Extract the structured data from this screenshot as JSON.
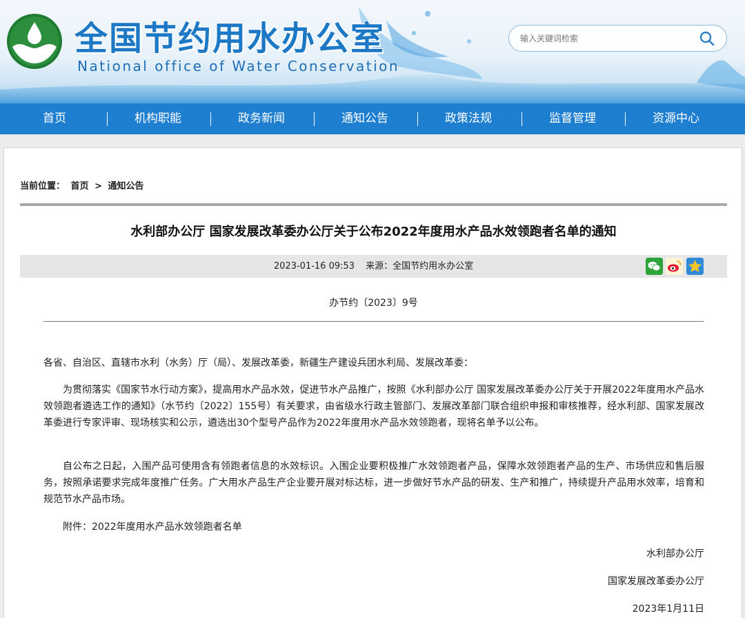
{
  "site": {
    "title": "全国节约用水办公室",
    "subtitle": "National office of Water Conservation"
  },
  "search": {
    "placeholder": "输入关键词检索",
    "icon": "search-icon"
  },
  "nav": {
    "items": [
      {
        "label": "首页"
      },
      {
        "label": "机构职能"
      },
      {
        "label": "政务新闻"
      },
      {
        "label": "通知公告"
      },
      {
        "label": "政策法规"
      },
      {
        "label": "监督管理"
      },
      {
        "label": "资源中心"
      }
    ],
    "separator": "|"
  },
  "breadcrumb": {
    "prefix": "当前位置：",
    "home": "首页",
    "arrow": ">",
    "current": "通知公告"
  },
  "article": {
    "title": "水利部办公厅 国家发展改革委办公厅关于公布2022年度用水产品水效领跑者名单的通知",
    "date": "2023-01-16 09:53",
    "source": "来源：全国节约用水办公室",
    "doc_no": "办节约〔2023〕9号",
    "salutation": "各省、自治区、直辖市水利（水务）厅（局）、发展改革委，新疆生产建设兵团水利局、发展改革委：",
    "paragraphs": [
      "为贯彻落实《国家节水行动方案》，提高用水产品水效，促进节水产品推广，按照《水利部办公厅 国家发展改革委办公厅关于开展2022年度用水产品水效领跑者遴选工作的通知》（水节约〔2022〕155号）有关要求，由省级水行政主管部门、发展改革部门联合组织申报和审核推荐，经水利部、国家发展改革委进行专家评审、现场核实和公示，遴选出30个型号产品作为2022年度用水产品水效领跑者，现将名单予以公布。",
      "自公布之日起，入围产品可使用含有领跑者信息的水效标识。入围企业要积极推广水效领跑者产品，保障水效领跑者产品的生产、市场供应和售后服务，按照承诺要求完成年度推广任务。广大用水产品生产企业要开展对标达标，进一步做好节水产品的研发、生产和推广，持续提升产品用水效率，培育和规范节水产品市场。"
    ],
    "attachment": "附件：2022年度用水产品水效领跑者名单",
    "signatories": [
      "水利部办公厅",
      "国家发展改革委办公厅"
    ],
    "sign_date": "2023年1月11日"
  },
  "share": {
    "icons": [
      "wechat-icon",
      "weibo-icon",
      "favorite-icon"
    ],
    "colors": {
      "wechat": "#2ea33a",
      "weibo": "#e6162d",
      "favorite": "#2f8ad8"
    }
  },
  "colors": {
    "nav_bg": "#1e7fd0",
    "title_blue": "#1d78c6",
    "logo_green": "#1f7a32"
  }
}
